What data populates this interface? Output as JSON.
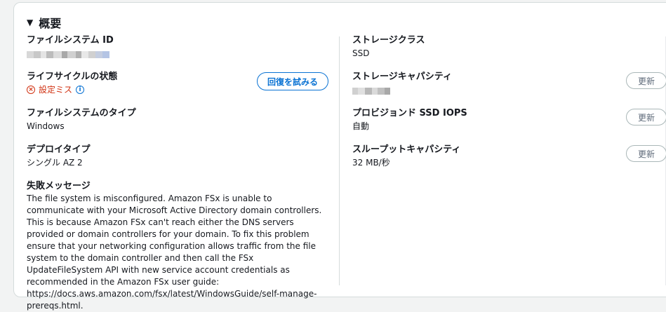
{
  "section": {
    "title": "概要"
  },
  "left": {
    "fs_id": {
      "label": "ファイルシステム ID"
    },
    "lifecycle": {
      "label": "ライフサイクルの状態",
      "value": "設定ミス",
      "action": "回復を試みる"
    },
    "fs_type": {
      "label": "ファイルシステムのタイプ",
      "value": "Windows"
    },
    "deploy": {
      "label": "デプロイタイプ",
      "value": "シングル AZ 2"
    },
    "failure": {
      "label": "失敗メッセージ",
      "message": "The file system is misconfigured. Amazon FSx is unable to communicate with your Microsoft Active Directory domain controllers. This is because Amazon FSx can't reach either the DNS servers provided or domain controllers for your domain. To fix this problem ensure that your networking configuration allows traffic from the file system to the domain controller and then call the FSx UpdateFileSystem API with new service account credentials as recommended in the Amazon FSx user guide: https://docs.aws.amazon.com/fsx/latest/WindowsGuide/self-manage-prereqs.html."
    }
  },
  "right": {
    "storage_class": {
      "label": "ストレージクラス",
      "value": "SSD"
    },
    "storage_capacity": {
      "label": "ストレージキャパシティ",
      "button": "更新"
    },
    "iops": {
      "label": "プロビジョンド SSD IOPS",
      "value": "自動",
      "button": "更新"
    },
    "throughput": {
      "label": "スループットキャパシティ",
      "value": "32 MB/秒",
      "button": "更新"
    }
  },
  "colors": {
    "error": "#d13212",
    "link": "#0972d3"
  }
}
